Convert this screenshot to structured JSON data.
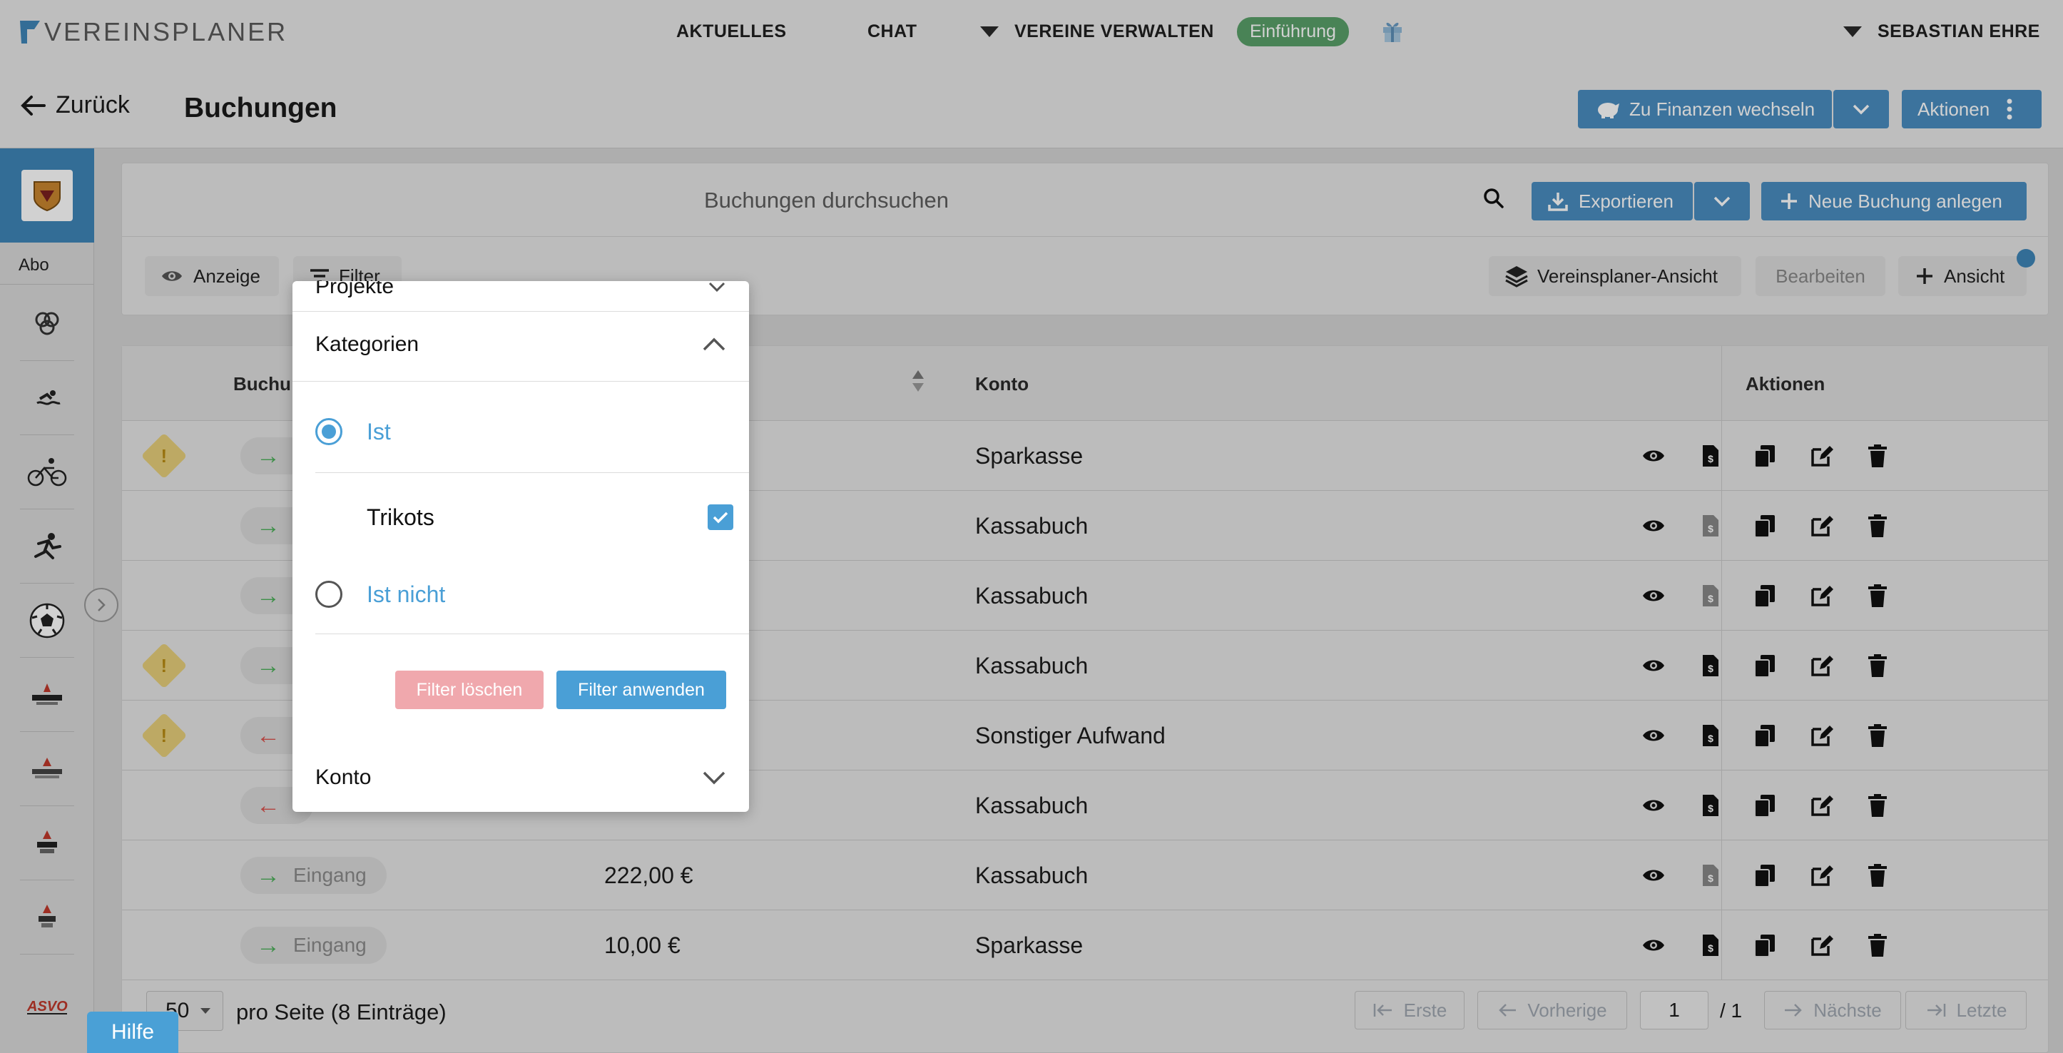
{
  "app": {
    "brand": "VEREINSPLANER"
  },
  "nav": {
    "aktuelles": "AKTUELLES",
    "chat": "CHAT",
    "vereine": "VEREINE VERWALTEN",
    "einfuehrung": "Einführung",
    "user": "SEBASTIAN EHRE"
  },
  "subheader": {
    "back": "Zurück",
    "title": "Buchungen",
    "finanzen": "Zu Finanzen wechseln",
    "aktionen": "Aktionen"
  },
  "sidebar": {
    "abo": "Abo"
  },
  "toolbar": {
    "search_placeholder": "Buchungen durchsuchen",
    "export": "Exportieren",
    "new": "Neue Buchung anlegen",
    "anzeige": "Anzeige",
    "filter": "Filter",
    "view_name": "Vereinsplaner-Ansicht",
    "edit": "Bearbeiten",
    "ansicht": "Ansicht"
  },
  "table": {
    "headers": {
      "buchung": "Buchu",
      "konto": "Konto",
      "aktionen": "Aktionen"
    },
    "rows": [
      {
        "warn": true,
        "dir": "in",
        "type": "",
        "amount": "",
        "konto": "Sparkasse",
        "doc": true
      },
      {
        "warn": false,
        "dir": "in",
        "type": "",
        "amount": "",
        "konto": "Kassabuch",
        "doc": false
      },
      {
        "warn": false,
        "dir": "in",
        "type": "",
        "amount": "",
        "konto": "Kassabuch",
        "doc": false
      },
      {
        "warn": true,
        "dir": "in",
        "type": "",
        "amount": "",
        "konto": "Kassabuch",
        "doc": true
      },
      {
        "warn": true,
        "dir": "out",
        "type": "",
        "amount": "",
        "konto": "Sonstiger Aufwand",
        "doc": true
      },
      {
        "warn": false,
        "dir": "out",
        "type": "",
        "amount": "",
        "konto": "Kassabuch",
        "doc": true
      },
      {
        "warn": false,
        "dir": "in",
        "type": "Eingang",
        "amount": "222,00 €",
        "konto": "Kassabuch",
        "doc": false
      },
      {
        "warn": false,
        "dir": "in",
        "type": "Eingang",
        "amount": "10,00 €",
        "konto": "Sparkasse",
        "doc": true
      }
    ]
  },
  "pager": {
    "per_page": "50",
    "summary": "pro Seite (8 Einträge)",
    "first": "Erste",
    "prev": "Vorherige",
    "page": "1",
    "total": "/ 1",
    "next": "Nächste",
    "last": "Letzte"
  },
  "popup": {
    "projekte": "Projekte",
    "kategorien": "Kategorien",
    "ist": "Ist",
    "trikots": "Trikots",
    "ist_nicht": "Ist nicht",
    "clear": "Filter löschen",
    "apply": "Filter anwenden",
    "konto": "Konto"
  },
  "help": "Hilfe",
  "colors": {
    "primary": "#4a8dc0",
    "accent": "#4a9fd6",
    "success": "#5aa06a",
    "danger_light": "#f0a8ad",
    "warning": "#e7cf7a"
  }
}
